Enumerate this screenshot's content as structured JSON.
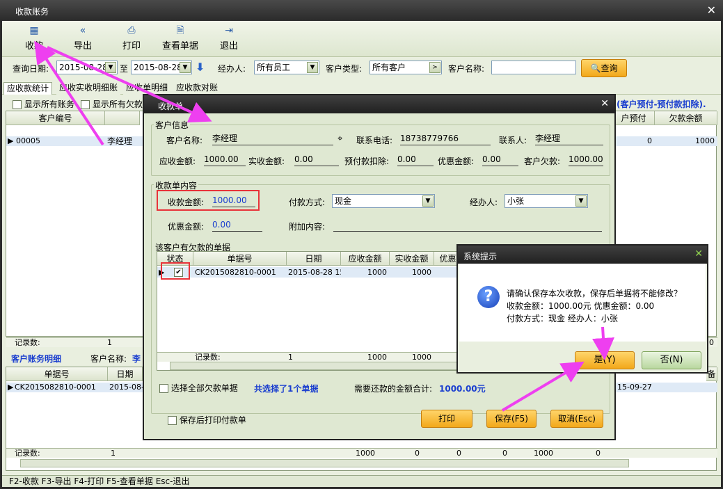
{
  "window": {
    "title": "收款账务"
  },
  "toolbar": {
    "collect": "收款",
    "export": "导出",
    "print": "打印",
    "view": "查看单据",
    "exit": "退出"
  },
  "filter": {
    "date_label": "查询日期:",
    "date_from": "2015-08-28",
    "date_to_label": "至",
    "date_to": "2015-08-28",
    "handler_label": "经办人:",
    "handler": "所有员工",
    "ctype_label": "客户类型:",
    "ctype": "所有客户",
    "cname_label": "客户名称:",
    "cname": "",
    "query": "查询"
  },
  "tabs": [
    "应收款统计",
    "应收实收明细账",
    "应收单明细",
    "应收款对账"
  ],
  "top_panel": {
    "show_all": "显示所有账务",
    "show_owed": "显示所有欠款",
    "note": "(客户预付-预付款扣除).",
    "col_code": "客户编号",
    "col_prepay": "户预付",
    "col_balance": "欠款余额",
    "row_code": "00005",
    "row_name": "李经理",
    "row_prepay": "0",
    "row_balance": "1000",
    "count_label": "记录数:",
    "count": "1",
    "count_right": "0"
  },
  "detail_panel": {
    "title": "客户账务明细",
    "cname_label": "客户名称:",
    "cname": "李",
    "col_no": "单据号",
    "col_date": "日期",
    "col_extra": "备",
    "row_no": "CK2015082810-0001",
    "row_date": "2015-08-",
    "row_due": "15-09-27",
    "count_label": "记录数:",
    "count": "1",
    "sums": [
      "1000",
      "0",
      "0",
      "0",
      "1000",
      "0"
    ]
  },
  "statusbar": {
    "text": "F2-收款 F3-导出 F4-打印 F5-查看单据 Esc-退出"
  },
  "dialog": {
    "title": "收款单",
    "cust_group": "客户信息",
    "cust_name_label": "客户名称:",
    "cust_name": "李经理",
    "phone_label": "联系电话:",
    "phone": "18738779766",
    "contact_label": "联系人:",
    "contact": "李经理",
    "due_label": "应收金额:",
    "due": "1000.00",
    "received_label": "实收金额:",
    "received": "0.00",
    "prepay_label": "预付款扣除:",
    "prepay": "0.00",
    "discount_label": "优惠金额:",
    "discount": "0.00",
    "owed_label": "客户欠款:",
    "owed": "1000.00",
    "bill_group": "收款单内容",
    "amount_label": "收款金额:",
    "amount": "1000.00",
    "paymethod_label": "付款方式:",
    "paymethod": "现金",
    "handler_label": "经办人:",
    "handler": "小张",
    "bill_discount_label": "优惠金额:",
    "bill_discount": "0.00",
    "extra_label": "附加内容:",
    "list_title": "该客户有欠款的单据",
    "col_status": "状态",
    "col_no": "单据号",
    "col_date": "日期",
    "col_due": "应收金额",
    "col_received": "实收金额",
    "col_discount": "优惠金",
    "row_no": "CK2015082810-0001",
    "row_date": "2015-08-28 15",
    "row_due": "1000",
    "row_received": "1000",
    "count_label": "记录数:",
    "count": "1",
    "sum_due": "1000",
    "sum_received": "1000",
    "select_all": "选择全部欠款单据",
    "selected_info": "共选择了1个单据",
    "total_label": "需要还款的金额合计:",
    "total": "1000.00元",
    "print_after": "保存后打印付款单",
    "btn_print": "打印",
    "btn_save": "保存(F5)",
    "btn_cancel": "取消(Esc)"
  },
  "confirm": {
    "title": "系统提示",
    "line1": "请确认保存本次收款，保存后单据将不能修改？",
    "line2": "收款金额：1000.00元    优惠金额：0.00",
    "line3": "付款方式：现金    经办人：小张",
    "yes": "是(Y)",
    "no": "否(N)"
  }
}
